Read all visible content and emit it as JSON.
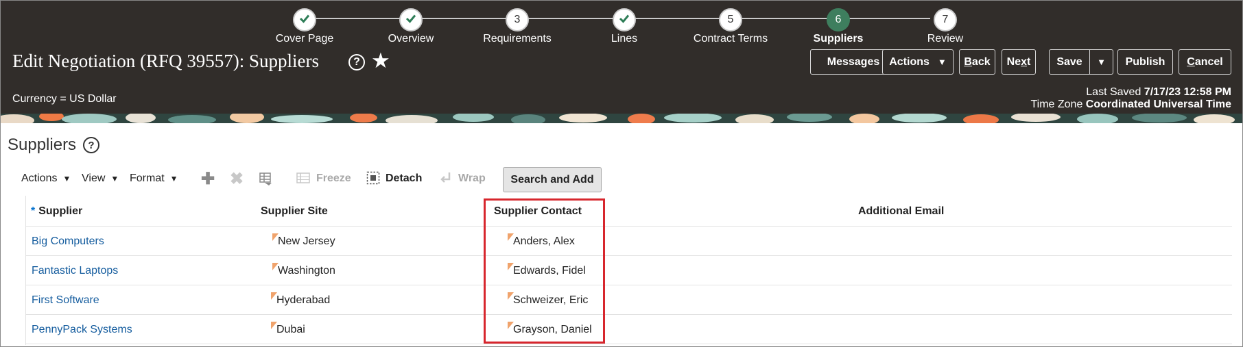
{
  "train": {
    "steps": [
      {
        "label": "Cover Page",
        "number": "",
        "status": "complete"
      },
      {
        "label": "Overview",
        "number": "",
        "status": "complete"
      },
      {
        "label": "Requirements",
        "number": "3",
        "status": "pending"
      },
      {
        "label": "Lines",
        "number": "",
        "status": "complete"
      },
      {
        "label": "Contract Terms",
        "number": "5",
        "status": "pending"
      },
      {
        "label": "Suppliers",
        "number": "6",
        "status": "current"
      },
      {
        "label": "Review",
        "number": "7",
        "status": "pending"
      }
    ]
  },
  "header": {
    "title": "Edit Negotiation (RFQ 39557): Suppliers",
    "help_icon": "question-circle-icon",
    "favorite_icon": "star-icon",
    "buttons": {
      "messages": "Messages",
      "actions": "Actions",
      "back_first": "B",
      "back_rest": "ack",
      "next_first": "Ne",
      "next_ul": "x",
      "next_rest": "t",
      "save": "Save",
      "publish": "Publish",
      "cancel_first": "C",
      "cancel_rest": "ancel"
    },
    "currency": "Currency = US Dollar",
    "last_saved_label": "Last Saved",
    "last_saved_value": "7/17/23 12:58 PM",
    "time_zone_label": "Time Zone",
    "time_zone_value": "Coordinated Universal Time"
  },
  "section": {
    "title": "Suppliers"
  },
  "toolbar": {
    "actions": "Actions",
    "view": "View",
    "format": "Format",
    "add_icon": "plus-icon",
    "delete_icon": "x-icon",
    "query_icon": "table-filter-icon",
    "freeze": "Freeze",
    "detach": "Detach",
    "wrap": "Wrap",
    "search_and_add": "Search and Add"
  },
  "table": {
    "columns": {
      "supplier": "Supplier",
      "site": "Supplier Site",
      "contact": "Supplier Contact",
      "email": "Additional Email"
    },
    "rows": [
      {
        "supplier": "Big Computers",
        "site": "New Jersey",
        "contact": "Anders, Alex",
        "email": ""
      },
      {
        "supplier": "Fantastic Laptops",
        "site": "Washington",
        "contact": "Edwards, Fidel",
        "email": ""
      },
      {
        "supplier": "First Software",
        "site": "Hyderabad",
        "contact": "Schweizer, Eric",
        "email": ""
      },
      {
        "supplier": "PennyPack Systems",
        "site": "Dubai",
        "contact": "Grayson, Daniel",
        "email": ""
      }
    ]
  },
  "colors": {
    "header_bg": "#312d2a",
    "current_step": "#3e7e5e",
    "link": "#145c9e",
    "highlight": "#d7262d",
    "required": "#0572ce"
  }
}
